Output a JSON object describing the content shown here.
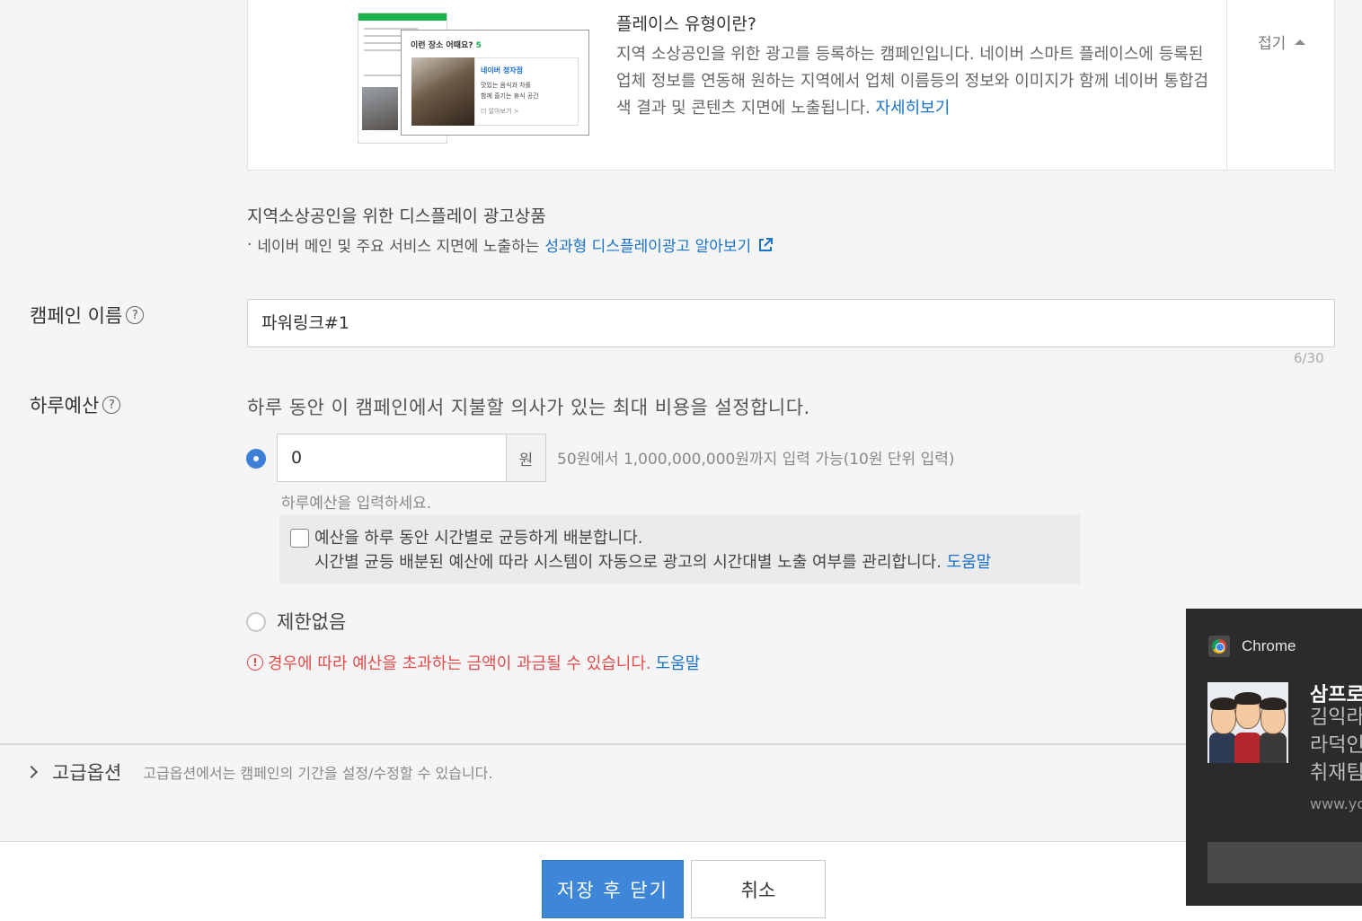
{
  "info": {
    "title": "플레이스 유형이란?",
    "desc": "지역 소상공인을 위한 광고를 등록하는 캠페인입니다. 네이버 스마트 플레이스에 등록된 업체 정보를 연동해 원하는 지역에서 업체 이름등의 정보와 이미지가 함께 네이버 통합검색 결과 및 콘텐츠 지면에 노출됩니다.",
    "more_link": "자세히보기",
    "collapse_label": "접기",
    "thumb": {
      "headline_prefix": "이런 장소 어때요? ",
      "headline_num": "5",
      "place_name": "네이버 정자점",
      "place_desc_1": "맛있는 음식과 차를",
      "place_desc_2": "함께 즐기는 휴식 공간",
      "place_more": "더 알아보기 >"
    }
  },
  "display_ad": {
    "title": "지역소상공인을 위한 디스플레이 광고상품",
    "bullet_text": "네이버 메인 및 주요 서비스 지면에 노출하는",
    "bullet_link": "성과형 디스플레이광고 알아보기"
  },
  "campaign_name": {
    "label": "캠페인 이름",
    "help": "?",
    "value": "파워링크#1",
    "counter": "6/30"
  },
  "daily_budget": {
    "label": "하루예산",
    "help": "?",
    "desc": "하루 동안 이 캠페인에서 지불할 의사가 있는 최대 비용을 설정합니다.",
    "amount_value": "0",
    "unit": "원",
    "hint": "50원에서 1,000,000,000원까지 입력 가능(10원 단위 입력)",
    "placeholder_msg": "하루예산을 입력하세요.",
    "distribute_line1": "예산을 하루 동안 시간별로 균등하게 배분합니다.",
    "distribute_line2": "시간별 균등 배분된 예산에 따라 시스템이 자동으로 광고의 시간대별 노출 여부를 관리합니다.",
    "distribute_help": "도움말",
    "unlimited_label": "제한없음",
    "warning": "경우에 따라 예산을 초과하는 금액이 과금될 수 있습니다.",
    "warning_help": "도움말",
    "selected_option": "amount"
  },
  "advanced": {
    "label": "고급옵션",
    "desc": "고급옵션에서는 캠페인의 기간을 설정/수정할 수 있습니다."
  },
  "buttons": {
    "save": "저장 후 닫기",
    "cancel": "취소"
  },
  "notification": {
    "app": "Chrome",
    "title": "삼프로",
    "body_1": "김익라",
    "body_2": "라덕인",
    "body_3": "취재팀",
    "url": "www.yo"
  },
  "colors": {
    "accent": "#3d86d8",
    "link": "#1a73c9",
    "warning": "#e24b4b"
  }
}
